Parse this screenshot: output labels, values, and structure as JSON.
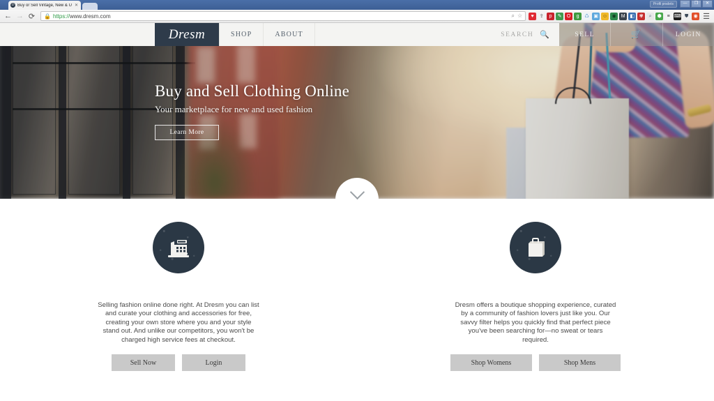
{
  "browser": {
    "tab": {
      "title": "Buy or Sell Vintage, New & U",
      "favicon_letter": "D",
      "close_icon": "✕"
    },
    "window": {
      "profile_label": "Profil prsdets",
      "minimize": "—",
      "maximize": "❐",
      "close": "✕"
    },
    "toolbar": {
      "back_icon": "←",
      "forward_icon": "→",
      "reload_icon": "⟳",
      "lock_icon": "🔒",
      "url_scheme": "https://",
      "url_rest": "www.dresm.com",
      "zoom_icon": "⌕",
      "star_icon": "☆",
      "menu_icon": "☰"
    },
    "extensions": [
      {
        "name": "heart-extension-icon",
        "glyph": "♥",
        "color": "#e02b34",
        "text": "#ffffff"
      },
      {
        "name": "upload-extension-icon",
        "glyph": "⇪",
        "color": "#f2f2f2",
        "text": "#4a4a4a"
      },
      {
        "name": "pinterest-extension-icon",
        "glyph": "p",
        "color": "#c8232c",
        "text": "#ffffff"
      },
      {
        "name": "eyedropper-extension-icon",
        "glyph": "✎",
        "color": "#3f9b4e",
        "text": "#ffffff"
      },
      {
        "name": "opera-extension-icon",
        "glyph": "O",
        "color": "#d81f26",
        "text": "#ffffff"
      },
      {
        "name": "green-badge-extension-icon",
        "glyph": "g",
        "color": "#3f9b3f",
        "text": "#ffffff"
      },
      {
        "name": "recycle-extension-icon",
        "glyph": "♺",
        "color": "#eef3f7",
        "text": "#3a8ac4"
      },
      {
        "name": "photo-extension-icon",
        "glyph": "▣",
        "color": "#5ea8dd",
        "text": "#ffffff"
      },
      {
        "name": "smiley-extension-icon",
        "glyph": "☺",
        "color": "#f0b828",
        "text": "#6a4a06"
      },
      {
        "name": "globe-extension-icon",
        "glyph": "◉",
        "color": "#2f8a4b",
        "text": "#10361e"
      },
      {
        "name": "mail-extension-icon",
        "glyph": "M",
        "color": "#39424b",
        "text": "#ffffff"
      },
      {
        "name": "blocks-extension-icon",
        "glyph": "◧",
        "color": "#3a6fb0",
        "text": "#ffffff"
      },
      {
        "name": "crab-extension-icon",
        "glyph": "✾",
        "color": "#c62f2f",
        "text": "#ffffff"
      },
      {
        "name": "magnifier-extension-icon",
        "glyph": "⌕",
        "color": "#e8e8e8",
        "text": "#5b6e86"
      },
      {
        "name": "shield-green-extension-icon",
        "glyph": "⬢",
        "color": "#49a84c",
        "text": "#ffffff"
      },
      {
        "name": "layers-extension-icon",
        "glyph": "≡",
        "color": "#f4f4f4",
        "text": "#333333"
      },
      {
        "name": "keyboard-extension-icon",
        "glyph": "⌨",
        "color": "#1c1c1c",
        "text": "#ffffff"
      },
      {
        "name": "shield-extension-icon",
        "glyph": "⛊",
        "color": "#efefef",
        "text": "#3c4a5a"
      },
      {
        "name": "flame-extension-icon",
        "glyph": "◉",
        "color": "#e2502a",
        "text": "#ffffff"
      }
    ]
  },
  "site": {
    "logo": "Dresm",
    "nav_links": [
      {
        "label": "SHOP"
      },
      {
        "label": "ABOUT"
      }
    ],
    "search": {
      "label": "SEARCH",
      "icon": "⌕"
    },
    "account_items": [
      {
        "label": "SELL",
        "type": "text"
      },
      {
        "label": "🛒",
        "type": "icon"
      },
      {
        "label": "LOGIN",
        "type": "text"
      }
    ],
    "hero": {
      "headline": "Buy and Sell Clothing Online",
      "subhead": "Your marketplace for new and used fashion",
      "cta": "Learn More",
      "scroll_icon": "chevron-down"
    },
    "columns": [
      {
        "icon": "cash-register-icon",
        "body": "Selling fashion online done right. At Dresm you can list and curate your clothing and accessories for free, creating your own store where you and your style stand out. And unlike our competitors, you won't be charged high service fees at checkout.",
        "buttons": [
          {
            "label": "Sell Now"
          },
          {
            "label": "Login"
          }
        ]
      },
      {
        "icon": "shopping-bag-icon",
        "body": "Dresm offers a boutique shopping experience, curated by a community of fashion lovers just like you. Our savvy filter helps you quickly find that perfect piece you've been searching for—no sweat or tears required.",
        "buttons": [
          {
            "label": "Shop Womens"
          },
          {
            "label": "Shop Mens"
          }
        ]
      }
    ]
  },
  "colors": {
    "brand_navy": "#2e3b4a",
    "button_gray": "#c9c9c9",
    "nav_bg": "#f4f4f2"
  }
}
